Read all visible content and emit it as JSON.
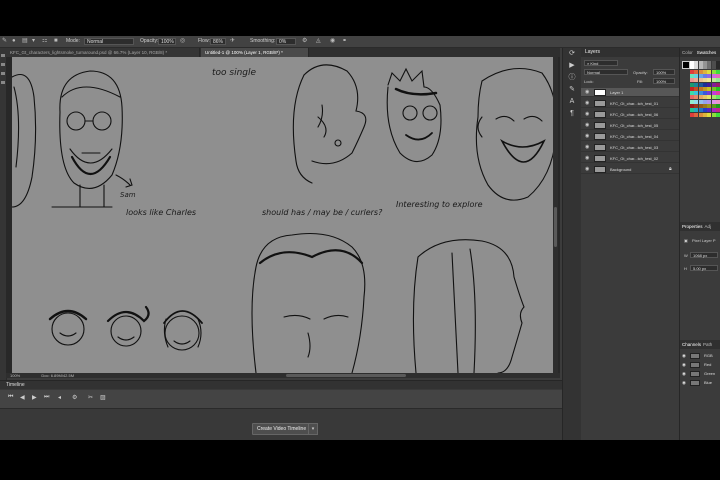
{
  "options_bar": {
    "mode_label": "Mode:",
    "mode_value": "Normal",
    "opacity_label": "Opacity:",
    "opacity_value": "100%",
    "flow_label": "Flow:",
    "flow_value": "86%",
    "smoothing_label": "Smoothing:",
    "smoothing_value": "0%"
  },
  "tabs": [
    {
      "label": "KFC_Gt_characters_lightsmoke_turnaround.psd @ 66.7% (Layer 10, RGB/8) *"
    },
    {
      "label": "Untitled-1 @ 100% (Layer 1, RGB/8*) *"
    }
  ],
  "canvas": {
    "note_top": "too single",
    "note_left": "looks like Charles",
    "note_arrow_label": "Sam",
    "note_middle": "should has / may be / curlers?",
    "note_right": "Interesting to explore"
  },
  "status": {
    "zoom": "100%",
    "doc": "Doc: 6.89M/42.5M"
  },
  "timeline": {
    "title": "Timeline",
    "create_button": "Create Video Timeline"
  },
  "layers_panel": {
    "title": "Layers",
    "kind_label": "Kind",
    "blend_mode": "Normal",
    "opacity_label": "Opacity:",
    "opacity_value": "100%",
    "lock_label": "Lock:",
    "fill_label": "Fill:",
    "fill_value": "100%",
    "layers": [
      {
        "name": "Layer 1"
      },
      {
        "name": "KFC_Gt_char...tch_test_01"
      },
      {
        "name": "KFC_Gt_char...tch_test_06"
      },
      {
        "name": "KFC_Gt_char...tch_test_05"
      },
      {
        "name": "KFC_Gt_char...tch_test_04"
      },
      {
        "name": "KFC_Gt_char...tch_test_03"
      },
      {
        "name": "KFC_Gt_char...tch_test_02"
      },
      {
        "name": "Background"
      }
    ]
  },
  "color_panel": {
    "tab_color": "Color",
    "tab_swatches": "Swatches"
  },
  "properties_panel": {
    "tab_properties": "Properties",
    "tab_adjustments": "Adj",
    "type_label": "Pixel Layer P",
    "w_label": "W",
    "w_value": "1068 px",
    "h_label": "H",
    "h_value": "5.00 px"
  },
  "channels_panel": {
    "tab_channels": "Channels",
    "tab_paths": "Path",
    "channels": [
      {
        "name": "RGB"
      },
      {
        "name": "Red"
      },
      {
        "name": "Green"
      },
      {
        "name": "Blue"
      }
    ]
  },
  "colors": {
    "canvas_bg": "#8f8f8f",
    "panel_bg": "#3b3b3b",
    "selected_layer": "#575757"
  }
}
